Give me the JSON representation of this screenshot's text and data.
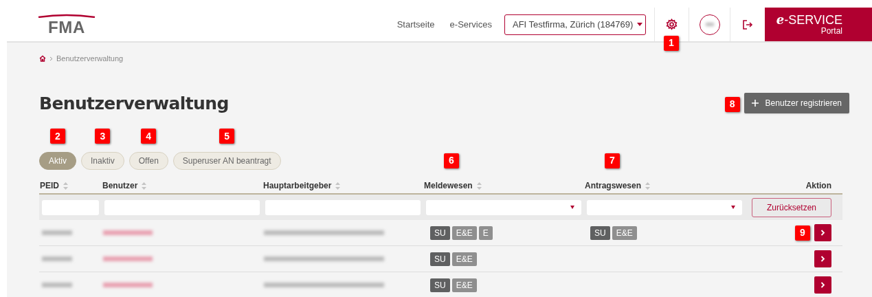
{
  "header": {
    "logo": "FMA",
    "nav": [
      "Startseite",
      "e-Services"
    ],
    "company_select": {
      "value": "AFI Testfirma, Zürich (184769)"
    },
    "settings_marker": "1",
    "portal": {
      "brand_prefix": "e",
      "brand": "-SERVICE",
      "sub": "Portal"
    }
  },
  "breadcrumb": {
    "current": "Benutzerverwaltung"
  },
  "title": "Benutzerverwaltung",
  "register_button": {
    "label": "Benutzer registrieren",
    "marker": "8"
  },
  "status_filters": [
    {
      "label": "Aktiv",
      "selected": true,
      "marker": "2"
    },
    {
      "label": "Inaktiv",
      "selected": false,
      "marker": "3"
    },
    {
      "label": "Offen",
      "selected": false,
      "marker": "4"
    },
    {
      "label": "Superuser AN beantragt",
      "selected": false,
      "marker": "5"
    }
  ],
  "table": {
    "columns": [
      {
        "label": "PEID",
        "sortable": true,
        "kind": "text"
      },
      {
        "label": "Benutzer",
        "sortable": true,
        "kind": "text"
      },
      {
        "label": "Hauptarbeitgeber",
        "sortable": true,
        "kind": "text"
      },
      {
        "label": "Meldewesen",
        "sortable": true,
        "kind": "select",
        "marker": "6"
      },
      {
        "label": "Antragswesen",
        "sortable": true,
        "kind": "select",
        "marker": "7"
      },
      {
        "label": "Aktion",
        "sortable": false,
        "kind": "reset",
        "reset_label": "Zurücksetzen"
      }
    ],
    "rows": [
      {
        "meldewesen": [
          {
            "label": "SU",
            "kind": "dark"
          },
          {
            "label": "E&E",
            "kind": "light"
          },
          {
            "label": "E",
            "kind": "light"
          }
        ],
        "antragswesen": [
          {
            "label": "SU",
            "kind": "dark"
          },
          {
            "label": "E&E",
            "kind": "light"
          }
        ],
        "marker": "9"
      },
      {
        "meldewesen": [
          {
            "label": "SU",
            "kind": "dark"
          },
          {
            "label": "E&E",
            "kind": "light"
          }
        ]
      },
      {
        "meldewesen": [
          {
            "label": "SU",
            "kind": "dark"
          },
          {
            "label": "E&E",
            "kind": "light"
          }
        ]
      }
    ]
  }
}
